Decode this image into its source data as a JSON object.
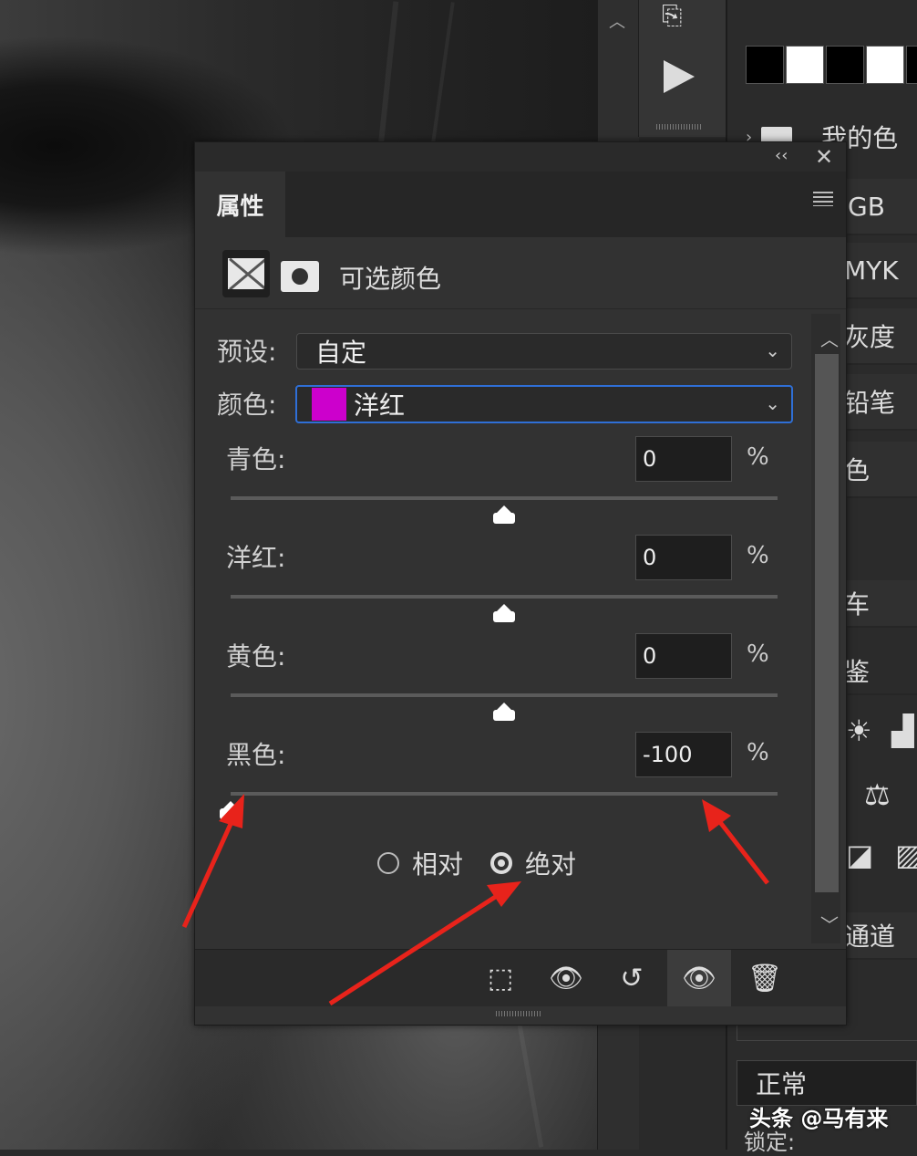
{
  "panel": {
    "tab_title": "属性",
    "adjustment_title": "可选颜色",
    "collapse_icon": "double-chevron-left",
    "close_icon": "close-x",
    "menu_icon": "panel-menu"
  },
  "preset": {
    "label": "预设:",
    "value": "自定"
  },
  "colors": {
    "label": "颜色:",
    "value": "洋红",
    "swatch": "#cc00cc"
  },
  "sliders": [
    {
      "label": "青色:",
      "value": "0",
      "unit": "%",
      "percent": 0
    },
    {
      "label": "洋红:",
      "value": "0",
      "unit": "%",
      "percent": 0
    },
    {
      "label": "黄色:",
      "value": "0",
      "unit": "%",
      "percent": 0
    },
    {
      "label": "黑色:",
      "value": "-100",
      "unit": "%",
      "percent": -100
    }
  ],
  "method": {
    "options": [
      "相对",
      "绝对"
    ],
    "selected": "绝对"
  },
  "footer_icons": [
    "clip-to-layer-icon",
    "view-previous-icon",
    "reset-icon",
    "toggle-visibility-icon",
    "delete-icon"
  ],
  "right_panel": {
    "swatch_colors": [
      "#000000",
      "#ffffff",
      "#000000",
      "#ffffff",
      "#000000"
    ],
    "folder_label": "我的色",
    "items": [
      "GB",
      "MYK",
      "灰度",
      "铅笔",
      "色"
    ],
    "partial_label_1": "车",
    "partial_label_2": "鉴",
    "channels_label": "通道",
    "blend_mode": "正常",
    "lock_label": "锁定:"
  },
  "watermark": "头条 @马有来",
  "accent": "#2f6fd6",
  "arrow_color": "#e8231b"
}
